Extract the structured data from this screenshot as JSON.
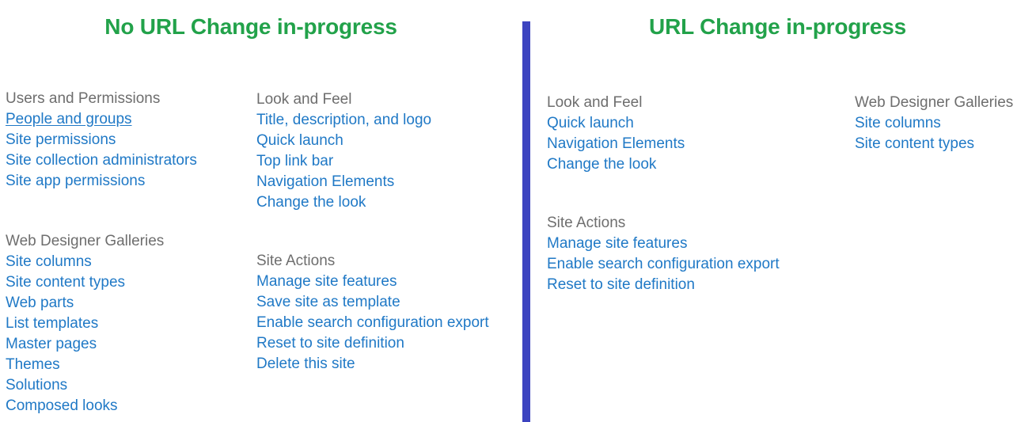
{
  "colors": {
    "panel_heading_green": "#22a24a",
    "group_heading_gray": "#6e6e6e",
    "link_blue": "#2079c6",
    "divider_blue": "#3d44c0",
    "background": "#ffffff"
  },
  "panels": [
    {
      "title": "No URL Change in-progress",
      "columns": [
        {
          "groups": [
            {
              "title": "Users and Permissions",
              "links": [
                {
                  "label": "People and groups",
                  "hovered": true
                },
                {
                  "label": "Site permissions",
                  "hovered": false
                },
                {
                  "label": "Site collection administrators",
                  "hovered": false
                },
                {
                  "label": "Site app permissions",
                  "hovered": false
                }
              ]
            },
            {
              "title": "Web Designer Galleries",
              "links": [
                {
                  "label": "Site columns",
                  "hovered": false
                },
                {
                  "label": "Site content types",
                  "hovered": false
                },
                {
                  "label": "Web parts",
                  "hovered": false
                },
                {
                  "label": "List templates",
                  "hovered": false
                },
                {
                  "label": "Master pages",
                  "hovered": false
                },
                {
                  "label": "Themes",
                  "hovered": false
                },
                {
                  "label": "Solutions",
                  "hovered": false
                },
                {
                  "label": "Composed looks",
                  "hovered": false
                }
              ]
            }
          ]
        },
        {
          "groups": [
            {
              "title": "Look and Feel",
              "links": [
                {
                  "label": "Title, description, and logo",
                  "hovered": false
                },
                {
                  "label": "Quick launch",
                  "hovered": false
                },
                {
                  "label": "Top link bar",
                  "hovered": false
                },
                {
                  "label": "Navigation Elements",
                  "hovered": false
                },
                {
                  "label": "Change the look",
                  "hovered": false
                }
              ]
            },
            {
              "title": "Site Actions",
              "links": [
                {
                  "label": "Manage site features",
                  "hovered": false
                },
                {
                  "label": "Save site as template",
                  "hovered": false
                },
                {
                  "label": "Enable search configuration export",
                  "hovered": false
                },
                {
                  "label": "Reset to site definition",
                  "hovered": false
                },
                {
                  "label": "Delete this site",
                  "hovered": false
                }
              ]
            }
          ]
        }
      ]
    },
    {
      "title": "URL Change in-progress",
      "columns": [
        {
          "groups": [
            {
              "title": "Look and Feel",
              "links": [
                {
                  "label": "Quick launch",
                  "hovered": false
                },
                {
                  "label": "Navigation Elements",
                  "hovered": false
                },
                {
                  "label": "Change the look",
                  "hovered": false
                }
              ]
            },
            {
              "title": "Site Actions",
              "links": [
                {
                  "label": "Manage site features",
                  "hovered": false
                },
                {
                  "label": "Enable search configuration export",
                  "hovered": false
                },
                {
                  "label": "Reset to site definition",
                  "hovered": false
                }
              ]
            }
          ]
        },
        {
          "groups": [
            {
              "title": "Web Designer Galleries",
              "links": [
                {
                  "label": "Site columns",
                  "hovered": false
                },
                {
                  "label": "Site content types",
                  "hovered": false
                }
              ]
            }
          ]
        }
      ]
    }
  ]
}
